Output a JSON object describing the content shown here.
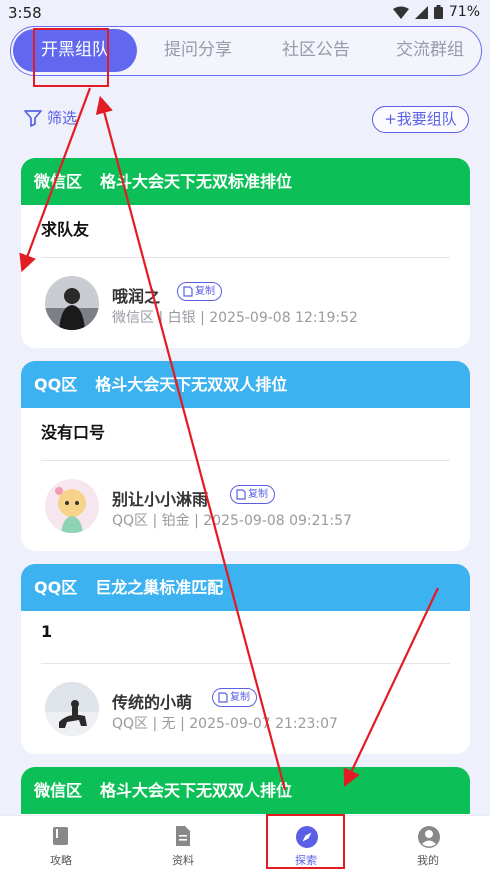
{
  "status": {
    "time": "3:58",
    "battery": "71%"
  },
  "tabs": [
    {
      "label": "开黑组队"
    },
    {
      "label": "提问分享"
    },
    {
      "label": "社区公告"
    },
    {
      "label": "交流群组"
    }
  ],
  "toolbar": {
    "filter_label": "筛选",
    "team_button": "+我要组队"
  },
  "posts": [
    {
      "zone": "微信区",
      "title": "格斗大会天下无双标准排位",
      "message": "求队友",
      "user": "哦润之",
      "copy_label": "复制",
      "meta": "微信区 | 白银 | 2025-09-08 12:19:52",
      "theme": "#0cc057"
    },
    {
      "zone": "QQ区",
      "title": "格斗大会天下无双双人排位",
      "message": "没有口号",
      "user": "别让小小淋雨",
      "copy_label": "复制",
      "meta": "QQ区 | 铂金 | 2025-09-08 09:21:57",
      "theme": "#3cb2f0"
    },
    {
      "zone": "QQ区",
      "title": "巨龙之巢标准匹配",
      "message": "1",
      "user": "传统的小萌",
      "copy_label": "复制",
      "meta": "QQ区 | 无 | 2025-09-07 21:23:07",
      "theme": "#3cb2f0"
    },
    {
      "zone": "微信区",
      "title": "格斗大会天下无双双人排位",
      "theme": "#0cc057"
    }
  ],
  "nav": [
    {
      "label": "攻略",
      "icon": "book-icon"
    },
    {
      "label": "资料",
      "icon": "document-icon"
    },
    {
      "label": "探索",
      "icon": "compass-icon"
    },
    {
      "label": "我的",
      "icon": "user-icon"
    }
  ],
  "colors": {
    "accent": "#5a5fe6",
    "annotation": "#e31b23"
  }
}
